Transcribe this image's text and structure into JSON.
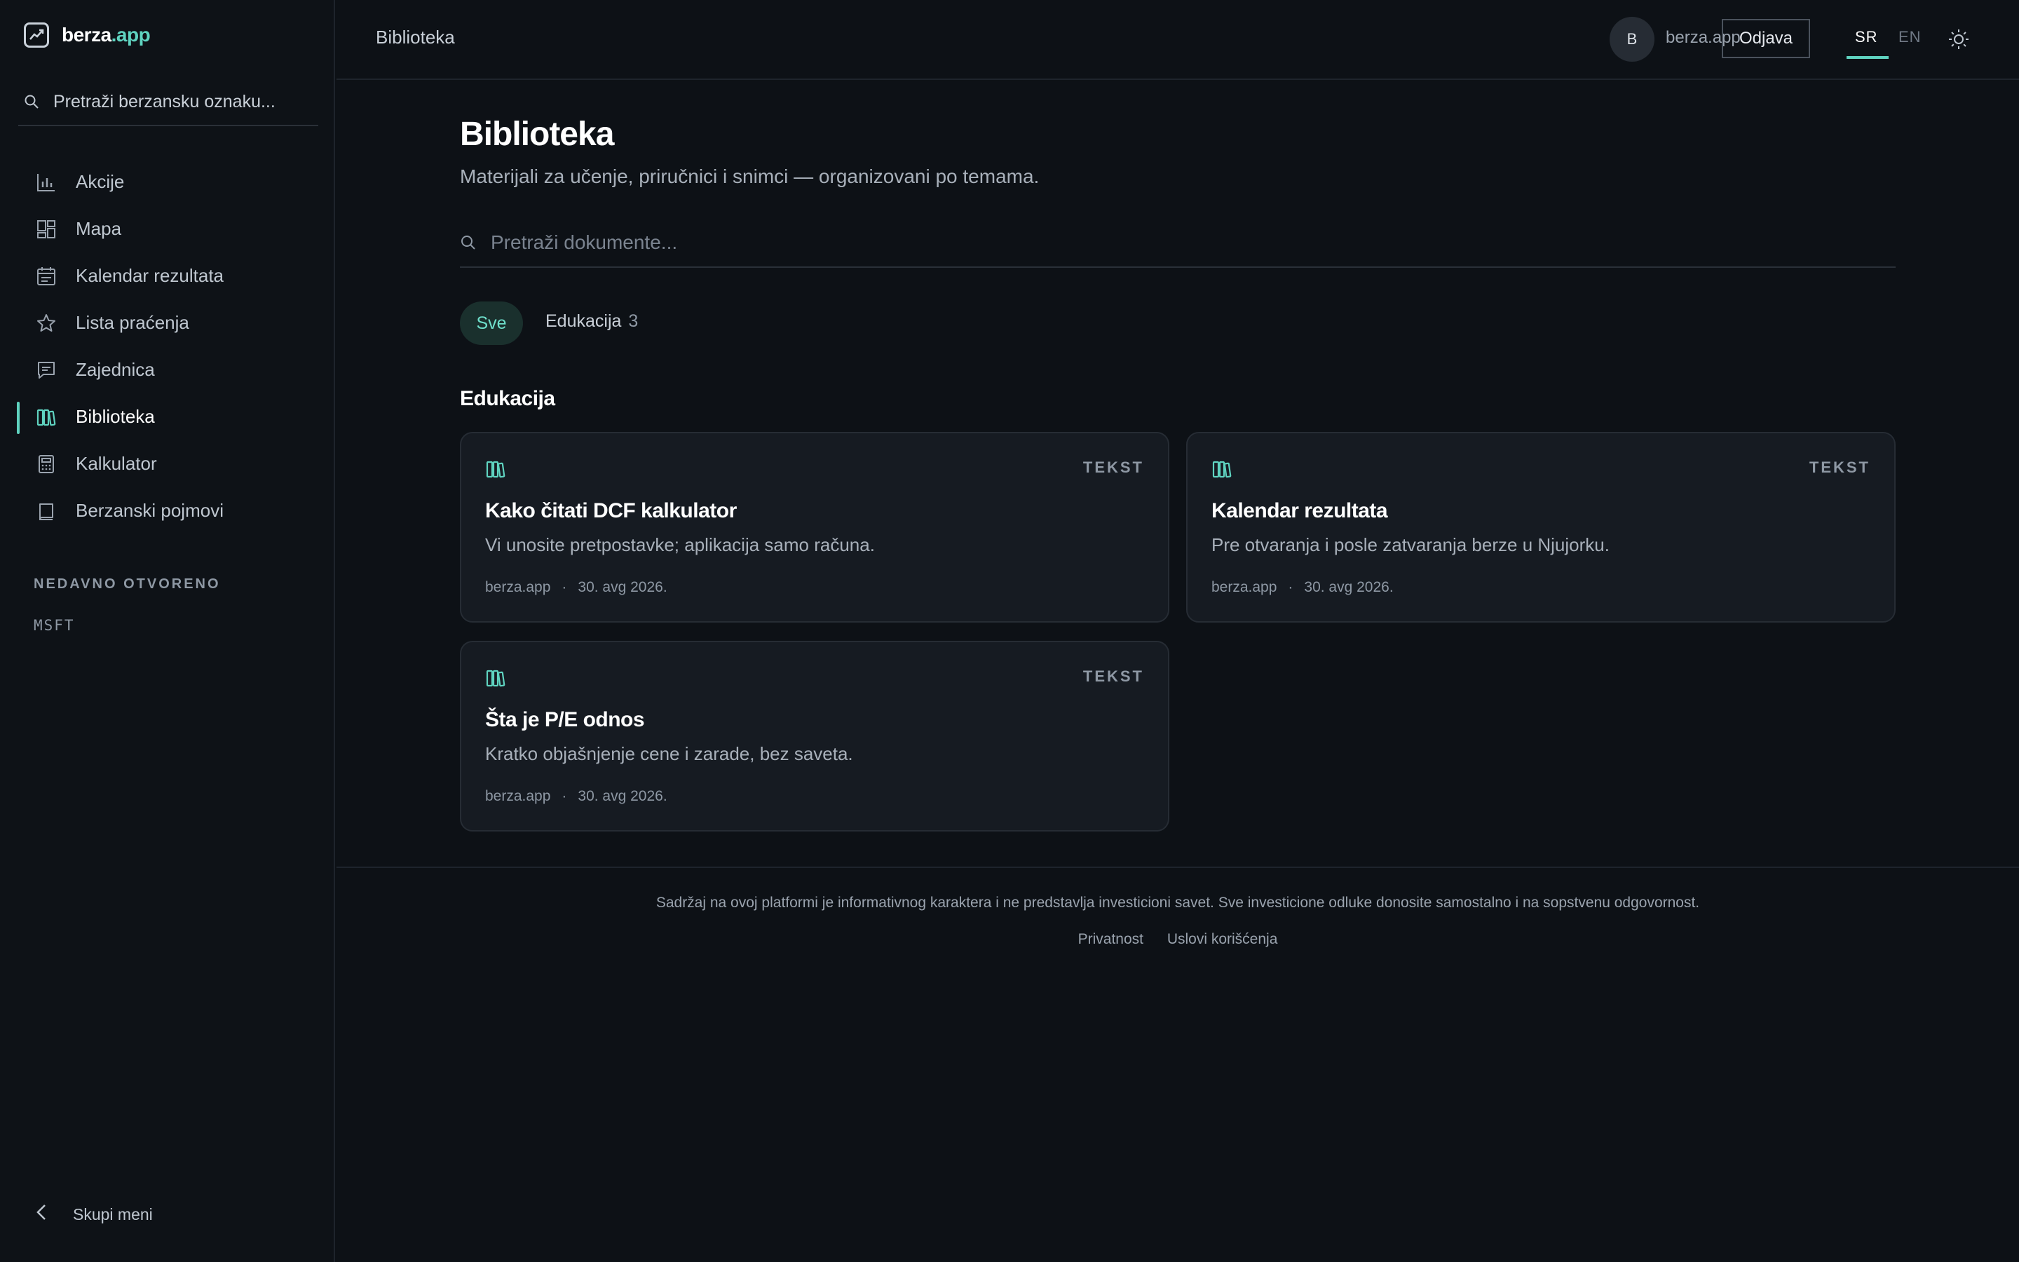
{
  "brand": {
    "name": "berza",
    "tld": ".app"
  },
  "sidebar": {
    "search_placeholder": "Pretraži berzansku oznaku...",
    "items": [
      {
        "label": "Akcije",
        "icon": "bar-chart-icon"
      },
      {
        "label": "Mapa",
        "icon": "grid-map-icon"
      },
      {
        "label": "Kalendar rezultata",
        "icon": "calendar-icon"
      },
      {
        "label": "Lista praćenja",
        "icon": "star-icon"
      },
      {
        "label": "Zajednica",
        "icon": "chat-icon"
      },
      {
        "label": "Biblioteka",
        "icon": "library-icon",
        "active": true
      },
      {
        "label": "Kalkulator",
        "icon": "calculator-icon"
      },
      {
        "label": "Berzanski pojmovi",
        "icon": "book-icon"
      }
    ],
    "recent_title": "NEDAVNO OTVORENO",
    "recent": [
      "MSFT"
    ],
    "collapse_label": "Skupi meni"
  },
  "header": {
    "breadcrumb": "Biblioteka",
    "avatar_initial": "B",
    "user": "berza.app",
    "logout": "Odjava",
    "lang_sr": "SR",
    "lang_en": "EN"
  },
  "main": {
    "title": "Biblioteka",
    "subtitle": "Materijali za učenje, priručnici i snimci — organizovani po temama.",
    "search_placeholder": "Pretraži dokumente...",
    "filters": {
      "all": "Sve",
      "edu": "Edukacija",
      "edu_count": "3"
    },
    "section": "Edukacija",
    "cards": [
      {
        "type": "TEKST",
        "title": "Kako čitati DCF kalkulator",
        "desc": "Vi unosite pretpostavke; aplikacija samo računa.",
        "source": "berza.app",
        "date": "30. avg 2026."
      },
      {
        "type": "TEKST",
        "title": "Kalendar rezultata",
        "desc": "Pre otvaranja i posle zatvaranja berze u Njujorku.",
        "source": "berza.app",
        "date": "30. avg 2026."
      },
      {
        "type": "TEKST",
        "title": "Šta je P/E odnos",
        "desc": "Kratko objašnjenje cene i zarade, bez saveta.",
        "source": "berza.app",
        "date": "30. avg 2026."
      }
    ]
  },
  "footer": {
    "disclaimer": "Sadržaj na ovoj platformi je informativnog karaktera i ne predstavlja investicioni savet. Sve investicione odluke donosite samostalno i na sopstvenu odgovornost.",
    "privacy": "Privatnost",
    "terms": "Uslovi korišćenja"
  },
  "colors": {
    "accent": "#5fd3c0",
    "background": "#0d1116",
    "card": "#161b22"
  }
}
